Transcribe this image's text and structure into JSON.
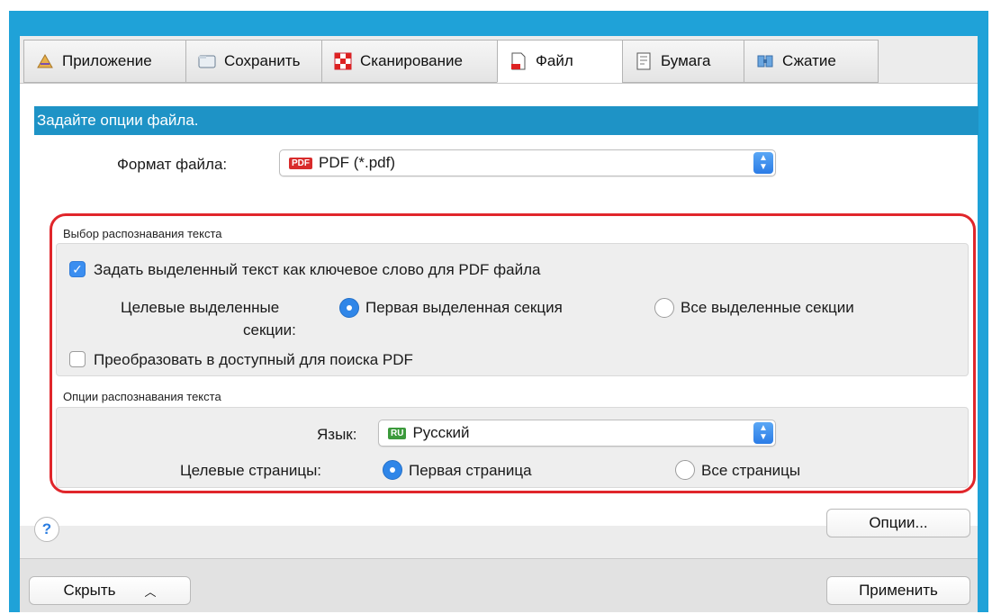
{
  "tabs": [
    {
      "label": "Приложение",
      "icon": "app-icon"
    },
    {
      "label": "Сохранить",
      "icon": "folder-icon"
    },
    {
      "label": "Сканирование",
      "icon": "scan-icon"
    },
    {
      "label": "Файл",
      "icon": "file-icon",
      "active": true
    },
    {
      "label": "Бумага",
      "icon": "paper-icon"
    },
    {
      "label": "Сжатие",
      "icon": "compress-icon"
    }
  ],
  "header": {
    "title": "Задайте опции файла."
  },
  "file_format": {
    "label": "Формат файла:",
    "value": "PDF (*.pdf)",
    "badge": "PDF"
  },
  "recognition_choice": {
    "title": "Выбор распознавания текста",
    "keyword_checkbox": {
      "label": "Задать выделенный текст как ключевое слово для PDF файла",
      "checked": true
    },
    "target_sections": {
      "label_line1": "Целевые выделенные",
      "label_line2": "секции:",
      "option_first": "Первая выделенная секция",
      "option_all": "Все выделенные секции",
      "selected": "first"
    },
    "searchable_checkbox": {
      "label": "Преобразовать в доступный для поиска PDF",
      "checked": false
    }
  },
  "recognition_options": {
    "title": "Опции распознавания текста",
    "language": {
      "label": "Язык:",
      "value": "Русский",
      "badge": "RU"
    },
    "target_pages": {
      "label": "Целевые страницы:",
      "option_first": "Первая страница",
      "option_all": "Все страницы",
      "selected": "first"
    }
  },
  "buttons": {
    "help": "?",
    "options": "Опции...",
    "hide": "Скрыть",
    "apply": "Применить"
  },
  "colors": {
    "accent": "#1e93c6",
    "highlight_frame": "#e0262b",
    "control_blue": "#2f86e8"
  }
}
